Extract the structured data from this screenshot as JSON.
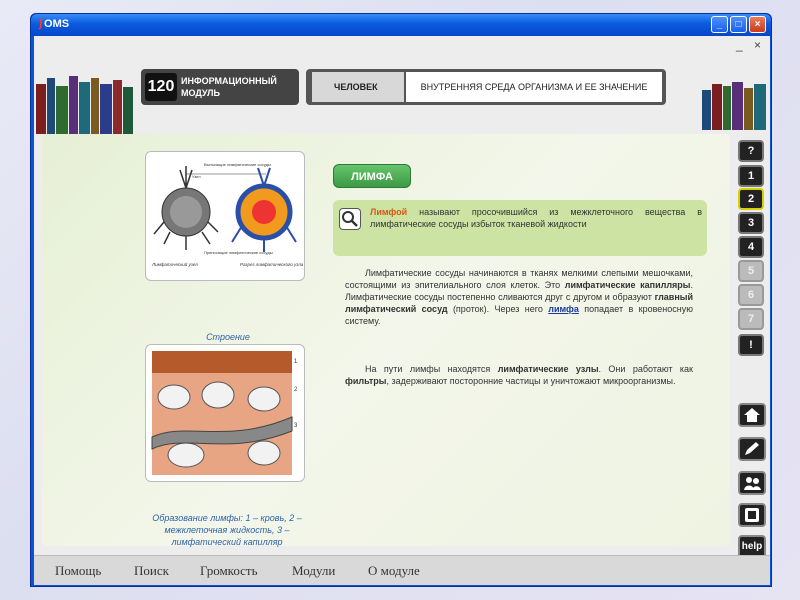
{
  "window": {
    "app_title": "OMS",
    "logo_glyph": "∫"
  },
  "window_buttons": {
    "minimize": "_",
    "maximize": "□",
    "close": "×"
  },
  "sub_window": {
    "minimize": "_",
    "close": "×"
  },
  "header": {
    "module_number": "120",
    "module_label_line1": "ИНФОРМАЦИОННЫЙ",
    "module_label_line2": "МОДУЛЬ",
    "subject": "ЧЕЛОВЕК",
    "theme": "ВНУТРЕННЯЯ СРЕДА ОРГАНИЗМА И ЕЕ ЗНАЧЕНИЕ"
  },
  "figures": {
    "fig1": {
      "caption": "Строение лимфатического узла",
      "labels": {
        "outgoing": "Выносящие лимфатические сосуды",
        "node": "Узел",
        "incoming": "Приносящие лимфатические сосуды",
        "node_name": "Лимфатический узел",
        "cut": "Разрез лимфатического узла"
      }
    },
    "fig2": {
      "caption": "Образование лимфы: 1 – кровь, 2 – межклеточная жидкость, 3 – лимфатический капилляр",
      "numbers": [
        "1",
        "2",
        "3"
      ]
    }
  },
  "content": {
    "title": "ЛИМФА",
    "definition": {
      "term": "Лимфой",
      "rest": " называют просочившийся из межклеточного вещества в лимфатические сосуды избыток тканевой жидкости"
    },
    "para1": {
      "t1": "Лимфатические сосуды начинаются в тканях мелкими слепыми мешочками, состоящими из эпителиального слоя клеток. Это ",
      "b1": "лимфатические капилляры",
      "t2": ". Лимфатические сосуды постепенно сливаются друг с другом и образуют ",
      "b2": "главный лимфатический сосуд",
      "t3": " (проток). Через него ",
      "link": "лимфа",
      "t4": " попадает в кровеносную систему."
    },
    "para2": {
      "t1": "На пути лимфы находятся ",
      "b1": "лимфатические узлы",
      "t2": ". Они работают как ",
      "b2": "фильтры",
      "t3": ", задерживают посторонние частицы и уничтожают микроорганизмы."
    }
  },
  "nav_buttons": [
    "?",
    "1",
    "2",
    "3",
    "4",
    "5",
    "6",
    "7",
    "!"
  ],
  "tool_buttons": [
    "home",
    "edit",
    "people",
    "film",
    "help"
  ],
  "tool_labels": {
    "help": "help"
  },
  "menu": [
    "Помощь",
    "Поиск",
    "Громкость",
    "Модули",
    "О модуле"
  ],
  "colors": {
    "titlebar": "#0a5ae0",
    "accent_green": "#3b9a44",
    "definition_bg": "#cde3a4",
    "term_orange": "#d55a10",
    "link_blue": "#1a3b9c"
  }
}
